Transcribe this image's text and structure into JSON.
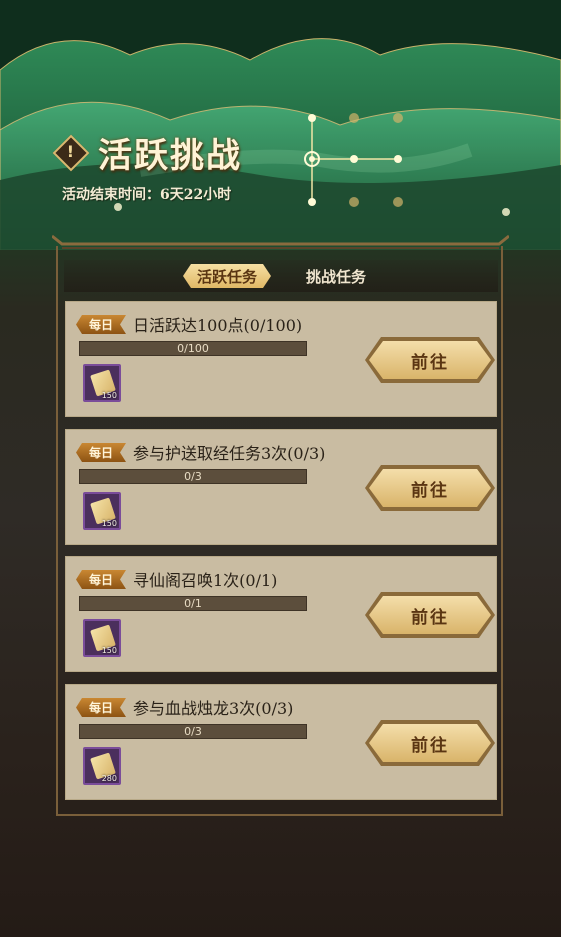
{
  "header": {
    "title": "活跃挑战",
    "alert_glyph": "!",
    "end_time": "活动结束时间：6天22小时"
  },
  "tabs": [
    {
      "label": "活跃任务",
      "active": true
    },
    {
      "label": "挑战任务",
      "active": false
    }
  ],
  "tasks": [
    {
      "badge": "每日",
      "name": "日活跃达100点(0/100)",
      "progress_text": "0/100",
      "progress": 0,
      "reward_icon": "scroll-icon",
      "reward_count": "150",
      "button": "前往"
    },
    {
      "badge": "每日",
      "name": "参与护送取经任务3次(0/3)",
      "progress_text": "0/3",
      "progress": 0,
      "reward_icon": "scroll-icon",
      "reward_count": "150",
      "button": "前往"
    },
    {
      "badge": "每日",
      "name": "寻仙阁召唤1次(0/1)",
      "progress_text": "0/1",
      "progress": 0,
      "reward_icon": "scroll-icon",
      "reward_count": "150",
      "button": "前往"
    },
    {
      "badge": "每日",
      "name": "参与血战烛龙3次(0/3)",
      "progress_text": "0/3",
      "progress": 0,
      "reward_icon": "scroll-icon",
      "reward_count": "280",
      "button": "前往"
    }
  ],
  "colors": {
    "accent_gold": "#e0b865",
    "card_bg": "#c9bca2",
    "badge": "#b5742a"
  }
}
